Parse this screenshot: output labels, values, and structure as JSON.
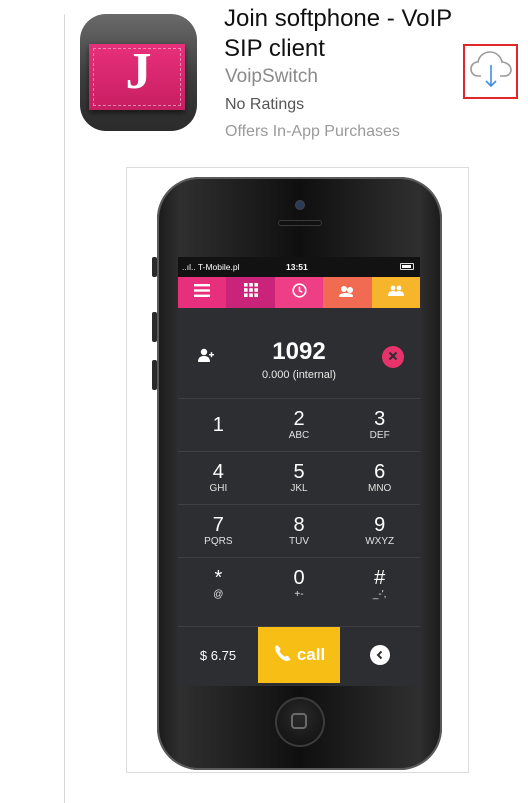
{
  "app": {
    "title": "Join softphone - VoIP SIP client",
    "developer": "VoipSwitch",
    "ratings": "No Ratings",
    "in_app": "Offers In-App Purchases",
    "icon_letter": "J",
    "download_icon": "cloud-download-icon"
  },
  "phone": {
    "status": {
      "carrier": "..ıl.. T-Mobile.pl",
      "time": "13:51"
    },
    "tabs": [
      {
        "name": "menu",
        "icon": "menu-icon",
        "color": "#e72f7d"
      },
      {
        "name": "keypad",
        "icon": "keypad-grid-icon",
        "color": "#c9237a"
      },
      {
        "name": "recents",
        "icon": "clock-icon",
        "color": "#ee3e85"
      },
      {
        "name": "contacts",
        "icon": "people-icon",
        "color": "#f06b52"
      },
      {
        "name": "groups",
        "icon": "group-icon",
        "color": "#f7b52b"
      }
    ],
    "dialed_number": "1092",
    "balance_line": "0.000 (internal)",
    "keys": [
      [
        {
          "digit": "1",
          "letters": ""
        },
        {
          "digit": "2",
          "letters": "ABC"
        },
        {
          "digit": "3",
          "letters": "DEF"
        }
      ],
      [
        {
          "digit": "4",
          "letters": "GHI"
        },
        {
          "digit": "5",
          "letters": "JKL"
        },
        {
          "digit": "6",
          "letters": "MNO"
        }
      ],
      [
        {
          "digit": "7",
          "letters": "PQRS"
        },
        {
          "digit": "8",
          "letters": "TUV"
        },
        {
          "digit": "9",
          "letters": "WXYZ"
        }
      ],
      [
        {
          "digit": "*",
          "letters": "@"
        },
        {
          "digit": "0",
          "letters": "+-"
        },
        {
          "digit": "#",
          "letters": "_-',"
        }
      ]
    ],
    "credit": "$ 6.75",
    "call_label": "call",
    "colors": {
      "accent_pink": "#e8326b",
      "call_yellow": "#f7be16",
      "screen_bg": "#2d2e31"
    }
  }
}
